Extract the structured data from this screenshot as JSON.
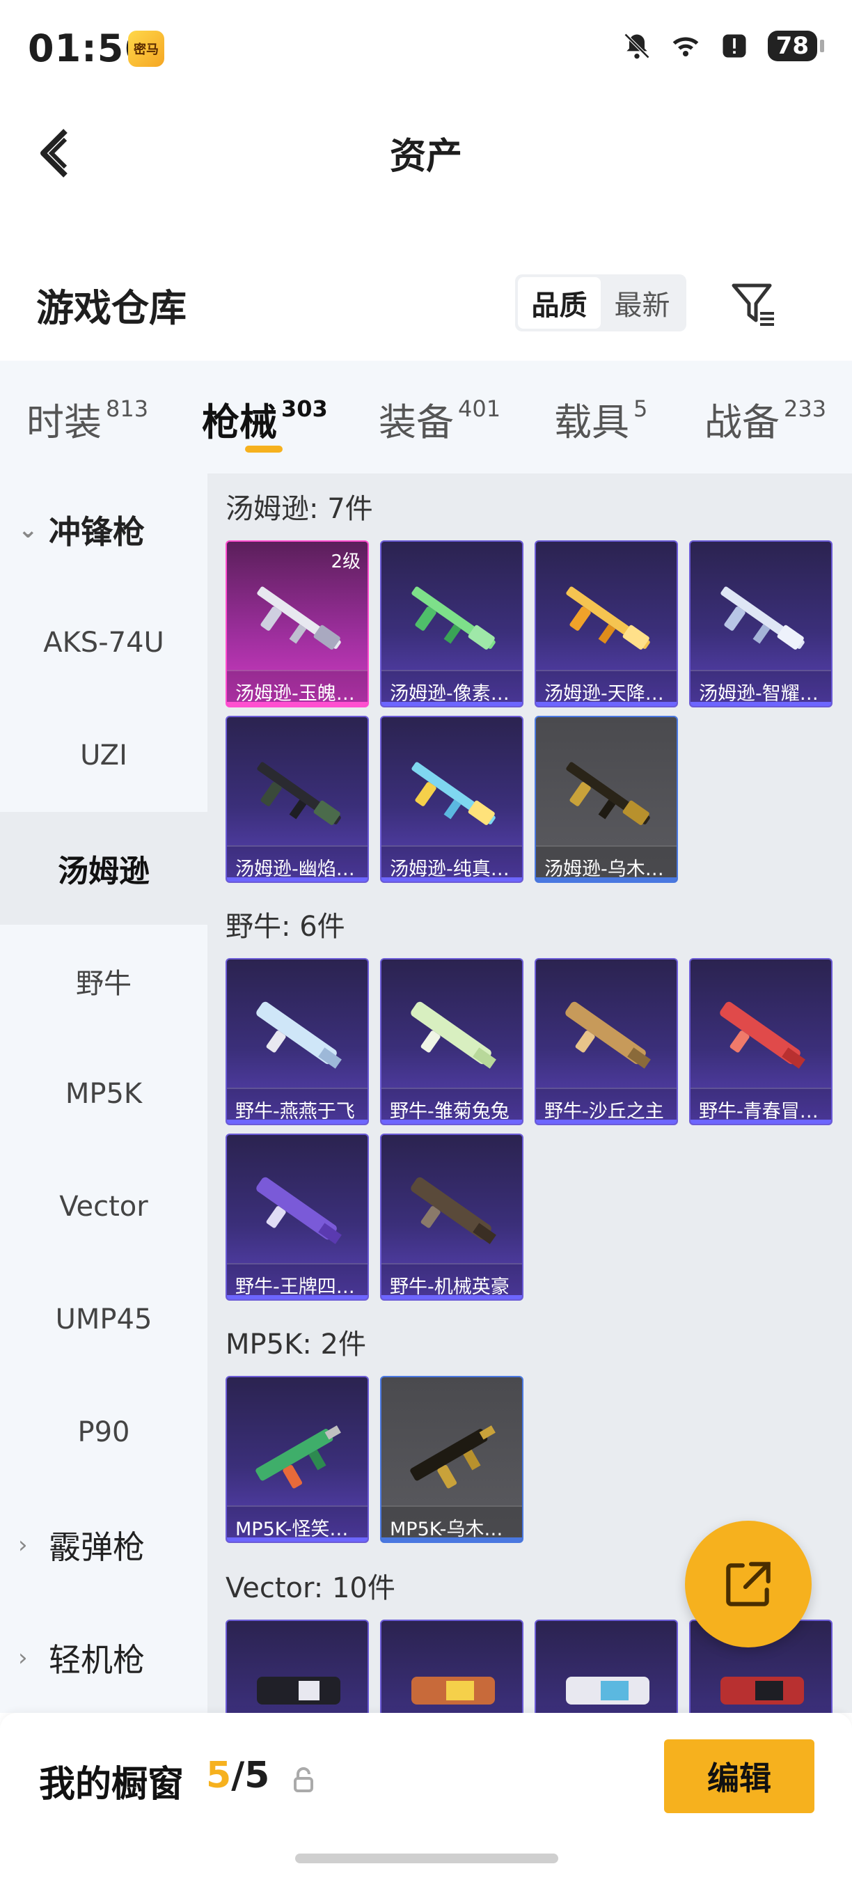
{
  "status": {
    "time": "01:56",
    "app_badge": "密马",
    "battery": "78"
  },
  "header": {
    "title": "资产"
  },
  "warehouse": {
    "title": "游戏仓库",
    "sort": [
      "品质",
      "最新"
    ]
  },
  "tabs": [
    {
      "label": "时装",
      "count": "813"
    },
    {
      "label": "枪械",
      "count": "303"
    },
    {
      "label": "装备",
      "count": "401"
    },
    {
      "label": "载具",
      "count": "5"
    },
    {
      "label": "战备",
      "count": "233"
    }
  ],
  "sidebar": {
    "groups": [
      "冲锋枪",
      "霰弹枪",
      "轻机枪"
    ],
    "items": [
      "AKS-74U",
      "UZI",
      "汤姆逊",
      "野牛",
      "MP5K",
      "Vector",
      "UMP45",
      "P90"
    ]
  },
  "sections": [
    {
      "title": "汤姆逊: 7件",
      "cards": [
        {
          "label": "汤姆逊-玉魄…",
          "level": "2级"
        },
        {
          "label": "汤姆逊-像素…"
        },
        {
          "label": "汤姆逊-天降…"
        },
        {
          "label": "汤姆逊-智耀…"
        },
        {
          "label": "汤姆逊-幽焰…"
        },
        {
          "label": "汤姆逊-纯真…"
        },
        {
          "label": "汤姆逊-乌木…"
        }
      ]
    },
    {
      "title": "野牛: 6件",
      "cards": [
        {
          "label": "野牛-燕燕于飞"
        },
        {
          "label": "野牛-雏菊兔兔"
        },
        {
          "label": "野牛-沙丘之主"
        },
        {
          "label": "野牛-青春冒…"
        },
        {
          "label": "野牛-王牌四…"
        },
        {
          "label": "野牛-机械英豪"
        }
      ]
    },
    {
      "title": "MP5K: 2件",
      "cards": [
        {
          "label": "MP5K-怪笑…"
        },
        {
          "label": "MP5K-乌木…"
        }
      ]
    },
    {
      "title": "Vector: 10件",
      "cards": []
    }
  ],
  "bottom": {
    "label": "我的橱窗",
    "count_num": "5",
    "count_total": "/5",
    "edit": "编辑"
  }
}
